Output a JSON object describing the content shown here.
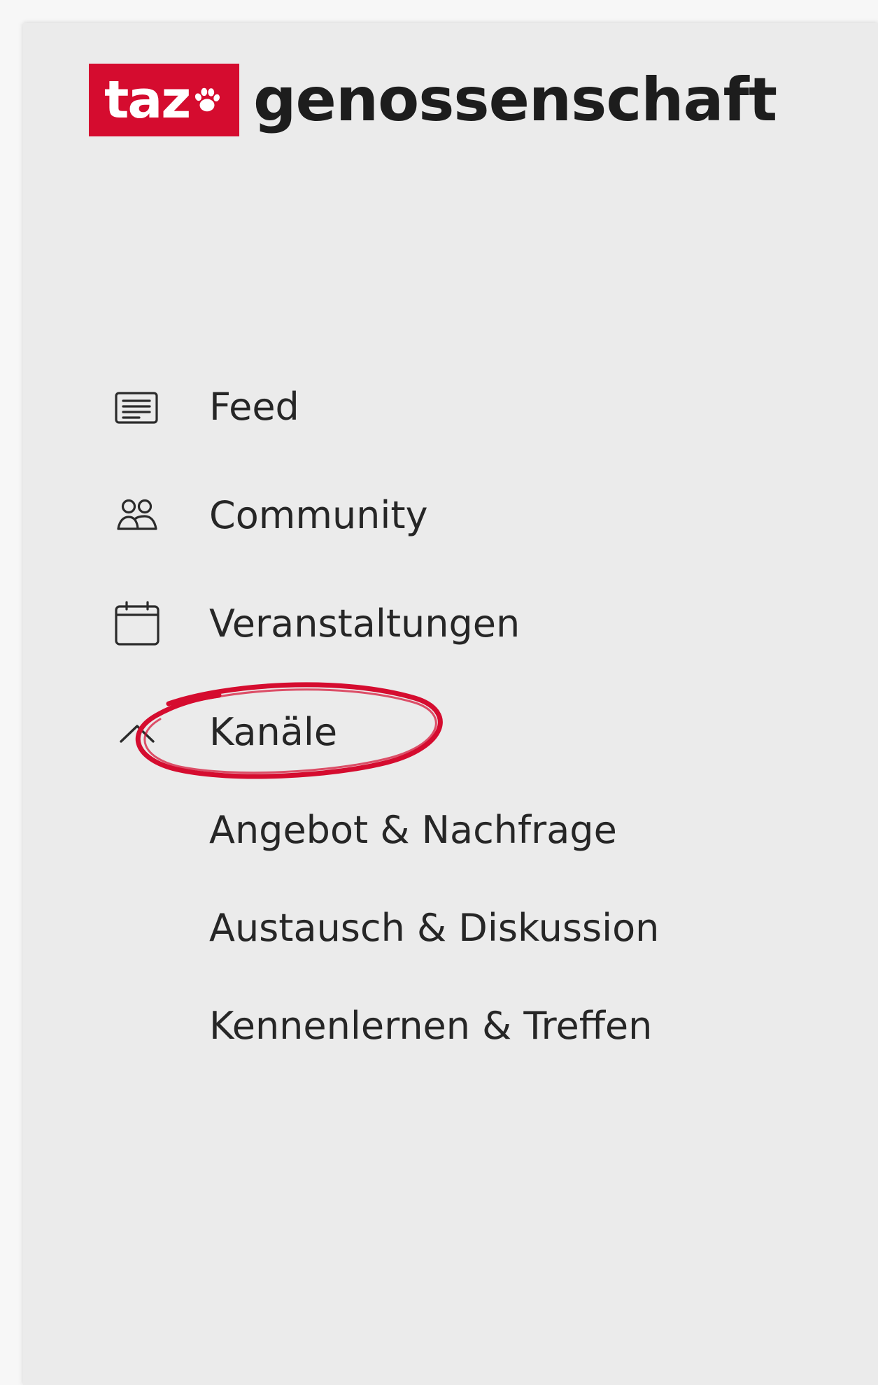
{
  "brand": {
    "logo_text": "taz",
    "logo_icon": "paw-icon",
    "name": "genossenschaft",
    "logo_color": "#d50c2f"
  },
  "nav": {
    "items": [
      {
        "label": "Feed",
        "icon": "feed-icon"
      },
      {
        "label": "Community",
        "icon": "community-icon"
      },
      {
        "label": "Veranstaltungen",
        "icon": "calendar-icon"
      },
      {
        "label": "Kanäle",
        "icon": "chevron-up-icon",
        "expanded": true
      }
    ],
    "channels": [
      {
        "label": "Angebot & Nachfrage"
      },
      {
        "label": "Austausch & Diskussion"
      },
      {
        "label": "Kennenlernen & Treffen"
      }
    ]
  },
  "annotation": {
    "color": "#d50c2f",
    "target": "Kanäle"
  }
}
